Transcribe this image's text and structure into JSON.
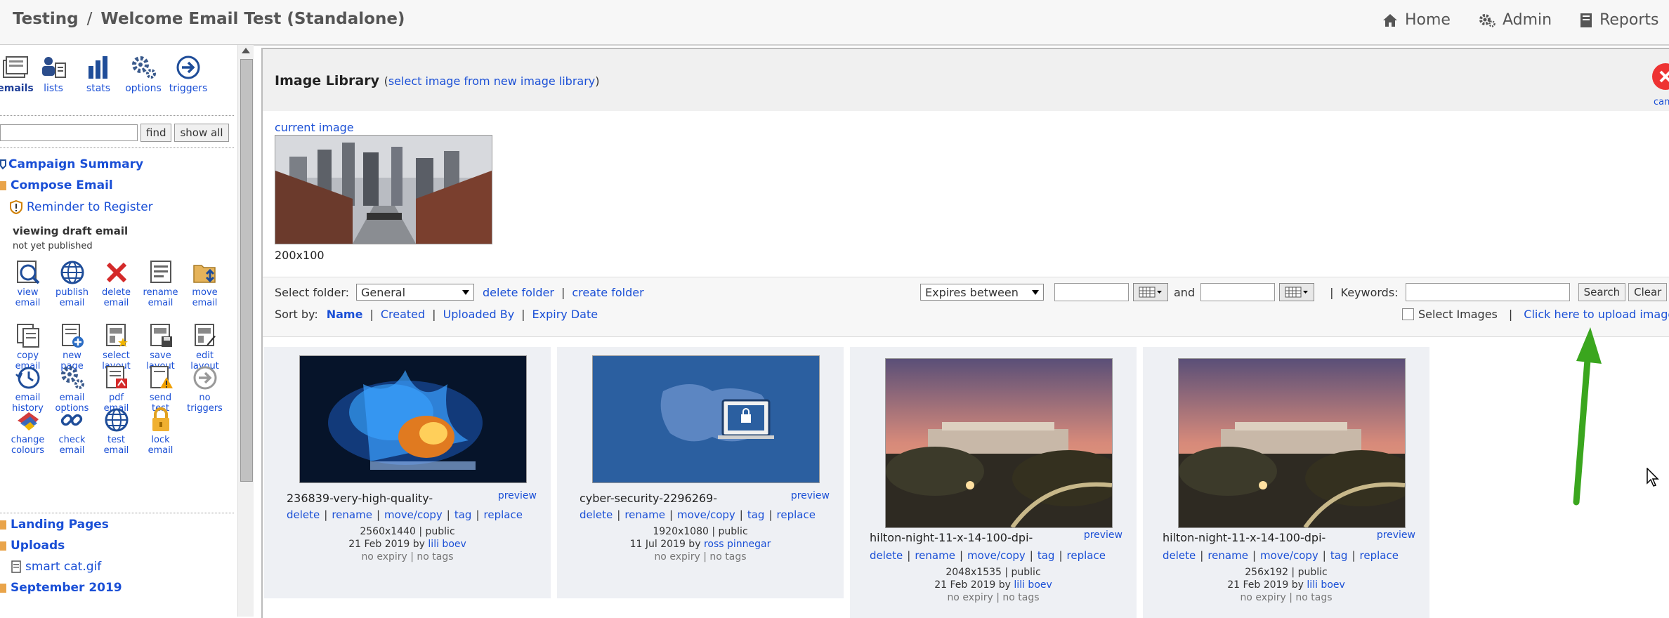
{
  "header": {
    "crumb_root": "Testing",
    "crumb_sep": "/",
    "crumb_page": "Welcome Email Test (Standalone)",
    "nav": [
      {
        "label": "Home",
        "icon": "home-icon"
      },
      {
        "label": "Admin",
        "icon": "admin-gear-icon"
      },
      {
        "label": "Reports",
        "icon": "reports-icon"
      }
    ]
  },
  "sidebar": {
    "top_tools": [
      {
        "label": "emails",
        "icon": "emails-icon",
        "active": true
      },
      {
        "label": "lists",
        "icon": "lists-icon"
      },
      {
        "label": "stats",
        "icon": "stats-icon"
      },
      {
        "label": "options",
        "icon": "options-icon"
      },
      {
        "label": "triggers",
        "icon": "triggers-icon"
      }
    ],
    "find_label": "find",
    "show_all_label": "show all",
    "campaign_summary": "Campaign Summary",
    "compose_email": "Compose Email",
    "reminder": "Reminder to Register",
    "viewing": "viewing draft email",
    "not_published": "not yet published",
    "action_rows": [
      [
        {
          "l1": "view",
          "l2": "email",
          "icon": "view-email-icon"
        },
        {
          "l1": "publish",
          "l2": "email",
          "icon": "publish-email-icon"
        },
        {
          "l1": "delete",
          "l2": "email",
          "icon": "delete-email-icon"
        },
        {
          "l1": "rename",
          "l2": "email",
          "icon": "rename-email-icon"
        },
        {
          "l1": "move",
          "l2": "email",
          "icon": "move-email-icon"
        }
      ],
      [
        {
          "l1": "copy",
          "l2": "email",
          "icon": "copy-email-icon"
        },
        {
          "l1": "new",
          "l2": "page",
          "icon": "new-page-icon"
        },
        {
          "l1": "select",
          "l2": "layout",
          "icon": "select-layout-icon"
        },
        {
          "l1": "save",
          "l2": "layout",
          "icon": "save-layout-icon"
        },
        {
          "l1": "edit",
          "l2": "layout",
          "icon": "edit-layout-icon"
        }
      ],
      [
        {
          "l1": "email",
          "l2": "history",
          "icon": "email-history-icon"
        },
        {
          "l1": "email",
          "l2": "options",
          "icon": "email-options-icon"
        },
        {
          "l1": "pdf",
          "l2": "email",
          "icon": "pdf-email-icon"
        },
        {
          "l1": "send",
          "l2": "test",
          "icon": "send-test-icon"
        },
        {
          "l1": "no",
          "l2": "triggers",
          "icon": "no-triggers-icon"
        }
      ],
      [
        {
          "l1": "change",
          "l2": "colours",
          "icon": "change-colours-icon"
        },
        {
          "l1": "check",
          "l2": "email",
          "icon": "check-email-icon"
        },
        {
          "l1": "test",
          "l2": "email",
          "icon": "test-email-icon"
        },
        {
          "l1": "lock",
          "l2": "email",
          "icon": "lock-email-icon"
        }
      ]
    ],
    "landing_pages": "Landing Pages",
    "uploads": "Uploads",
    "upload_file": "smart cat.gif",
    "september": "September 2019"
  },
  "library": {
    "title": "Image Library",
    "paren_open": "(",
    "subtitle_link": "select image from new image library",
    "paren_close": ")",
    "cancel_label": "cancel",
    "current_image_label": "current image",
    "current_size": "200x100",
    "filters": {
      "select_folder_label": "Select folder:",
      "folder_value": "General",
      "delete_folder": "delete folder",
      "create_folder": "create folder",
      "expires_value": "Expires between",
      "and_label": "and",
      "keywords_label": "Keywords:",
      "search_btn": "Search",
      "clear_btn": "Clear",
      "sort_by_label": "Sort by:",
      "sort_options": [
        "Name",
        "Created",
        "Uploaded By",
        "Expiry Date"
      ],
      "select_images_label": "Select Images",
      "upload_link": "Click here to upload images"
    },
    "images": [
      {
        "name": "236839-very-high-quality-",
        "preview": "preview",
        "size": "2560x1440",
        "visibility": "public",
        "date": "21 Feb 2019 by",
        "user": "lili boev",
        "expiry": "no expiry",
        "tags": "no tags"
      },
      {
        "name": "cyber-security-2296269-",
        "preview": "preview",
        "size": "1920x1080",
        "visibility": "public",
        "date": "11 Jul 2019 by",
        "user": "ross pinnegar",
        "expiry": "no expiry",
        "tags": "no tags"
      },
      {
        "name": "hilton-night-11-x-14-100-dpi-",
        "preview": "preview",
        "size": "2048x1535",
        "visibility": "public",
        "date": "21 Feb 2019 by",
        "user": "lili boev",
        "expiry": "no expiry",
        "tags": "no tags"
      },
      {
        "name": "hilton-night-11-x-14-100-dpi-",
        "preview": "preview",
        "size": "256x192",
        "visibility": "public",
        "date": "21 Feb 2019 by",
        "user": "lili boev",
        "expiry": "no expiry",
        "tags": "no tags"
      }
    ],
    "card_actions": [
      "delete",
      "rename",
      "move/copy",
      "tag",
      "replace"
    ]
  }
}
